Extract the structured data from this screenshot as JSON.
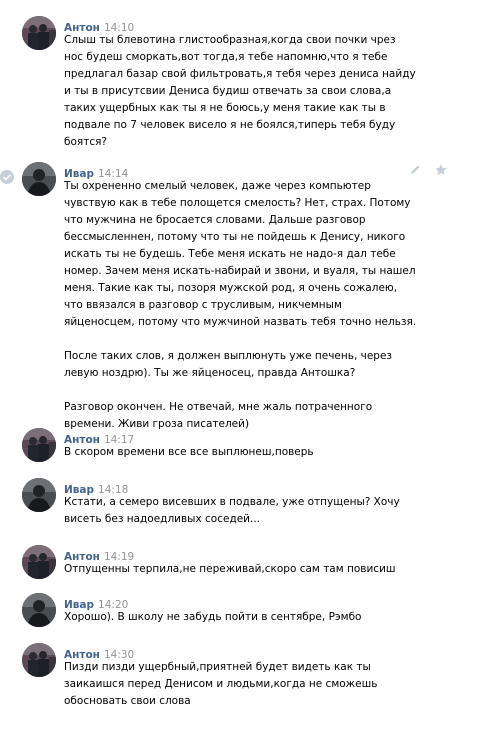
{
  "colors": {
    "author": "#42648b",
    "time": "#939393",
    "text": "#000000",
    "icon": "#c5d0db"
  },
  "messages": [
    {
      "author": "Антон",
      "time": "14:10",
      "avatar": "anton",
      "paragraphs": [
        [
          "Слыш ты блевотина глистообразная,когда свои почки чрез",
          "нос будеш сморкать,вот тогда,я тебе напомню,что я тебе",
          "предлагал базар свой фильтровать,я тебя через дениса найду",
          "и ты в присутсвии Дениса будиш отвечать за свои слова,а",
          "таких ущербных как ты я не боюсь,у меня такие как ты в",
          "подвале по 7 человек висело я не боялся,типерь тебя буду",
          "боятся?"
        ]
      ]
    },
    {
      "author": "Ивар",
      "time": "14:14",
      "avatar": "ivar",
      "hovered": true,
      "paragraphs": [
        [
          "Ты охрененно смелый человек, даже через компьютер",
          "чувствую как в тебе полощется смелость? Нет, страх. Потому",
          "что мужчина не бросается словами. Дальше разговор",
          "бессмысленнен, потому что ты не пойдешь к Денису, никого",
          "искать ты не будешь. Тебе меня искать не надо-я дал тебе",
          "номер. Зачем меня искать-набирай и звони, и вуаля, ты нашел",
          "меня. Такие как ты, позоря мужской род, я очень сожалею,",
          "что ввязался в разговор с трусливым, никчемным",
          "яйценосцем, потому что мужчиной назвать тебя точно нельзя."
        ],
        [
          "После таких слов, я должен выплюнуть уже печень, через",
          "левую ноздрю). Ты же яйценосец, правда Антошка?"
        ],
        [
          "Разговор окончен. Не отвечай, мне жаль потраченного",
          "времени. Живи гроза писателей)"
        ]
      ]
    },
    {
      "author": "Антон",
      "time": "14:17",
      "avatar": "anton",
      "paragraphs": [
        [
          "В скором времени все все выплюнеш,поверь"
        ]
      ]
    },
    {
      "author": "Ивар",
      "time": "14:18",
      "avatar": "ivar",
      "paragraphs": [
        [
          "Кстати, а семеро висевших в подвале, уже отпущены? Хочу",
          "висеть без надоедливых соседей..."
        ]
      ]
    },
    {
      "author": "Антон",
      "time": "14:19",
      "avatar": "anton",
      "paragraphs": [
        [
          "Отпущенны терпила,не переживай,скоро сам там повисиш"
        ]
      ]
    },
    {
      "author": "Ивар",
      "time": "14:20",
      "avatar": "ivar",
      "paragraphs": [
        [
          "Хорошо). В школу не забудь пойти в сентябре, Рэмбо"
        ]
      ]
    },
    {
      "author": "Антон",
      "time": "14:30",
      "avatar": "anton",
      "paragraphs": [
        [
          "Пизди пизди ущербный,приятней будет видеть как ты",
          "заикаишся перед Денисом и людьми,когда не сможешь",
          "обосновать свои слова"
        ]
      ]
    }
  ]
}
